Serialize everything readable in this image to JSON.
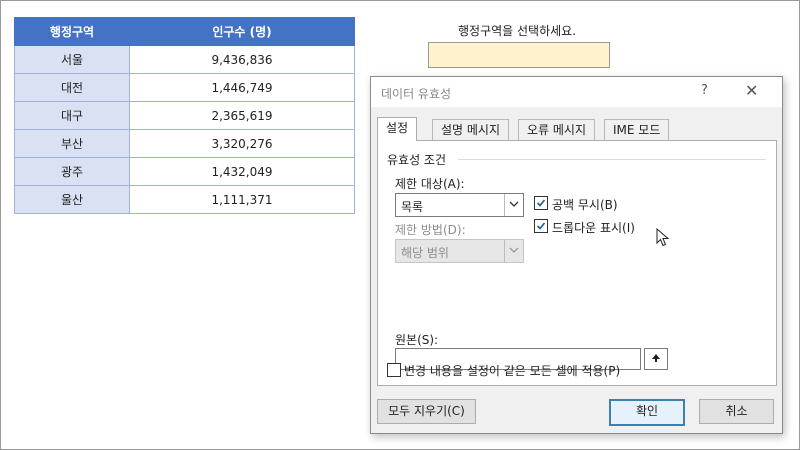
{
  "sheet": {
    "headers": [
      "행정구역",
      "인구수 (명)"
    ],
    "rows": [
      {
        "region": "서울",
        "population": "9,436,836"
      },
      {
        "region": "대전",
        "population": "1,446,749"
      },
      {
        "region": "대구",
        "population": "2,365,619"
      },
      {
        "region": "부산",
        "population": "3,320,276"
      },
      {
        "region": "광주",
        "population": "1,432,049"
      },
      {
        "region": "울산",
        "population": "1,111,371"
      }
    ],
    "prompt": "행정구역을 선택하세요.",
    "input_cell_color": "#fff2cc",
    "header_color": "#4472c4",
    "region_cell_color": "#d9e1f2"
  },
  "dialog": {
    "title": "데이터 유효성",
    "help": "?",
    "close": "✕",
    "tabs": [
      "설정",
      "설명 메시지",
      "오류 메시지",
      "IME 모드"
    ],
    "active_tab": "설정",
    "group_title": "유효성 조건",
    "allow_label": "제한 대상(A):",
    "allow_value": "목록",
    "data_label": "제한 방법(D):",
    "data_value": "해당 범위",
    "ignore_blank_label": "공백 무시(B)",
    "ignore_blank_checked": true,
    "dropdown_label": "드롭다운 표시(I)",
    "dropdown_checked": true,
    "source_label": "원본(S):",
    "source_value": "",
    "apply_all_label": "변경 내용을 설정이 같은 모든 셀에 적용(P)",
    "apply_all_checked": false,
    "clear_all": "모두 지우기(C)",
    "ok": "확인",
    "cancel": "취소"
  },
  "icons": {
    "cursor": "mouse-pointer-icon",
    "collapse": "collapse-range-icon"
  }
}
